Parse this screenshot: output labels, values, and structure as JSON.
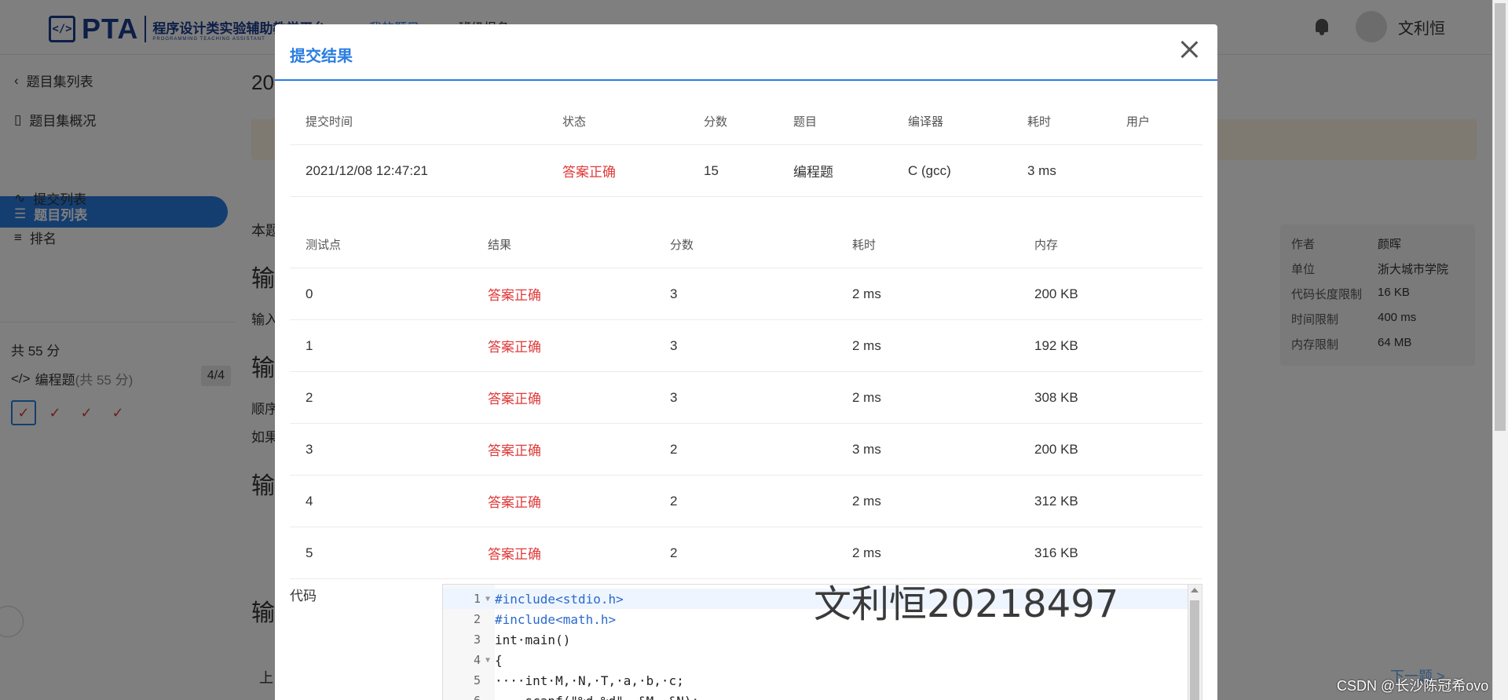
{
  "header": {
    "logo_mark": "</>",
    "logo_name": "PTA",
    "logo_cn": "程序设计类实验辅助教学平台",
    "logo_en": "PROGRAMMING TEACHING ASSISTANT",
    "tabs": [
      "我的题目",
      "班级报名"
    ],
    "username": "文利恒"
  },
  "sidebar": {
    "back": "题目集列表",
    "overview": "题目集概况",
    "problem_list": "题目列表",
    "submissions": "提交列表",
    "ranking": "排名",
    "total_score": "共 55 分",
    "category": "编程题",
    "category_score": "(共 55 分)",
    "progress": "4/4",
    "checks": [
      "✓",
      "✓",
      "✓",
      "✓"
    ]
  },
  "background": {
    "page_title_prefix": "20",
    "frag_1": "本题",
    "frag_2": "输",
    "frag_3": "输入",
    "frag_4": "输",
    "frag_5": "顺序",
    "frag_6": "如果",
    "frag_7": "输",
    "frag_8": "输",
    "info": [
      {
        "k": "作者",
        "v": "颜晖"
      },
      {
        "k": "单位",
        "v": "浙大城市学院"
      },
      {
        "k": "代码长度限制",
        "v": "16 KB"
      },
      {
        "k": "时间限制",
        "v": "400 ms"
      },
      {
        "k": "内存限制",
        "v": "64 MB"
      }
    ],
    "prev": "上",
    "next": "下一题 >"
  },
  "modal": {
    "title": "提交结果",
    "submission_headers": [
      "提交时间",
      "状态",
      "分数",
      "题目",
      "编译器",
      "耗时",
      "用户"
    ],
    "submission": [
      "2021/12/08 12:47:21",
      "答案正确",
      "15",
      "编程题",
      "C (gcc)",
      "3 ms",
      ""
    ],
    "case_headers": [
      "测试点",
      "结果",
      "分数",
      "耗时",
      "内存"
    ],
    "cases": [
      [
        "0",
        "答案正确",
        "3",
        "2 ms",
        "200 KB"
      ],
      [
        "1",
        "答案正确",
        "3",
        "2 ms",
        "192 KB"
      ],
      [
        "2",
        "答案正确",
        "3",
        "2 ms",
        "308 KB"
      ],
      [
        "3",
        "答案正确",
        "2",
        "3 ms",
        "200 KB"
      ],
      [
        "4",
        "答案正确",
        "2",
        "2 ms",
        "312 KB"
      ],
      [
        "5",
        "答案正确",
        "2",
        "2 ms",
        "316 KB"
      ]
    ],
    "code_label": "代码",
    "code_lines": [
      {
        "n": "1",
        "text": "#include<stdio.h>"
      },
      {
        "n": "2",
        "text": "#include<math.h>"
      },
      {
        "n": "3",
        "text": "int·main()"
      },
      {
        "n": "4",
        "text": "{"
      },
      {
        "n": "5",
        "text": "····int·M,·N,·T,·a,·b,·c;"
      },
      {
        "n": "6",
        "text": "····scanf(\"%d·%d\",·&M,·&N);"
      }
    ]
  },
  "watermark": "文利恒20218497",
  "csdn": "CSDN @长沙陈冠希ovo"
}
